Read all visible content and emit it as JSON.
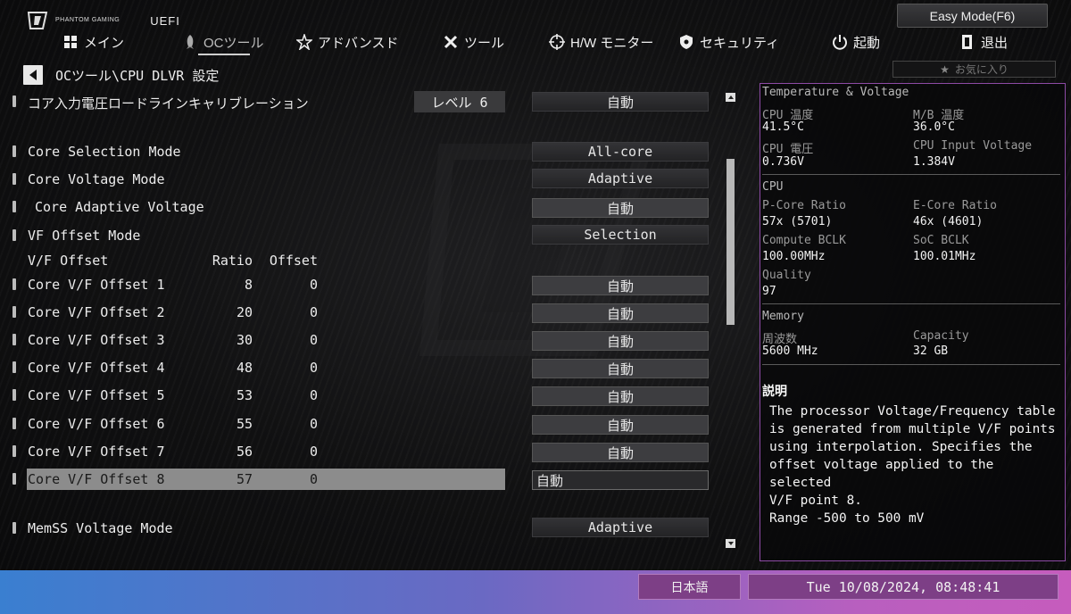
{
  "brand": {
    "logo_text": "PHANTOM GAMING",
    "uefi": "UEFI"
  },
  "easy_mode_label": "Easy Mode(F6)",
  "nav": [
    {
      "id": "main",
      "label": "メイン",
      "icon": "grid-icon"
    },
    {
      "id": "oc",
      "label": "OCツール",
      "icon": "rocket-icon",
      "active": true
    },
    {
      "id": "advanced",
      "label": "アドバンスド",
      "icon": "star-icon"
    },
    {
      "id": "tool",
      "label": "ツール",
      "icon": "tools-icon"
    },
    {
      "id": "hw",
      "label": "H/W モニター",
      "icon": "crosshair-icon"
    },
    {
      "id": "security",
      "label": "セキュリティ",
      "icon": "shield-icon"
    },
    {
      "id": "boot",
      "label": "起動",
      "icon": "power-icon"
    },
    {
      "id": "exit",
      "label": "退出",
      "icon": "exit-icon"
    }
  ],
  "favorites_label": "お気に入り",
  "breadcrumb": "OCツール\\CPU DLVR 設定",
  "settings": {
    "llc": {
      "label": "コア入力電圧ロードラインキャリブレーション",
      "level": "レベル 6",
      "value": "自動"
    },
    "core_selection": {
      "label": "Core Selection Mode",
      "value": "All-core"
    },
    "core_voltage_mode": {
      "label": "Core Voltage Mode",
      "value": "Adaptive"
    },
    "core_adaptive": {
      "label": "Core Adaptive Voltage",
      "value": "自動"
    },
    "vf_offset_mode": {
      "label": "VF Offset Mode",
      "value": "Selection"
    },
    "vf_header": {
      "col1": "V/F Offset",
      "col2": "Ratio",
      "col3": "Offset"
    },
    "vf_rows": [
      {
        "label": "Core V/F Offset 1",
        "ratio": "8",
        "offset": "0",
        "value": "自動"
      },
      {
        "label": "Core V/F Offset 2",
        "ratio": "20",
        "offset": "0",
        "value": "自動"
      },
      {
        "label": "Core V/F Offset 3",
        "ratio": "30",
        "offset": "0",
        "value": "自動"
      },
      {
        "label": "Core V/F Offset 4",
        "ratio": "48",
        "offset": "0",
        "value": "自動"
      },
      {
        "label": "Core V/F Offset 5",
        "ratio": "53",
        "offset": "0",
        "value": "自動"
      },
      {
        "label": "Core V/F Offset 6",
        "ratio": "55",
        "offset": "0",
        "value": "自動"
      },
      {
        "label": "Core V/F Offset 7",
        "ratio": "56",
        "offset": "0",
        "value": "自動"
      },
      {
        "label": "Core V/F Offset 8",
        "ratio": "57",
        "offset": "0",
        "value": "自動"
      }
    ],
    "memss": {
      "label": "MemSS Voltage Mode",
      "value": "Adaptive"
    }
  },
  "monitor": {
    "tv_title": "Temperature & Voltage",
    "cpu_temp_label": "CPU 温度",
    "cpu_temp": "41.5°C",
    "mb_temp_label": "M/B 温度",
    "mb_temp": "36.0°C",
    "cpu_volt_label": "CPU 電圧",
    "cpu_volt": "0.736V",
    "cpu_input_label": "CPU Input Voltage",
    "cpu_input": "1.384V",
    "cpu_title": "CPU",
    "pcore_label": "P-Core Ratio",
    "pcore": "57x (5701)",
    "ecore_label": "E-Core Ratio",
    "ecore": "46x (4601)",
    "bclk_label": "Compute BCLK",
    "bclk": "100.00MHz",
    "soc_label": "SoC BCLK",
    "soc": "100.01MHz",
    "quality_label": "Quality",
    "quality": "97",
    "mem_title": "Memory",
    "freq_label": "周波数",
    "freq": "5600 MHz",
    "cap_label": "Capacity",
    "cap": "32 GB",
    "desc_title": "説明",
    "desc": "The processor Voltage/Frequency table\nis generated from multiple V/F points\nusing interpolation. Specifies the\noffset voltage applied to the selected\nV/F point 8.\nRange -500 to 500 mV"
  },
  "footer": {
    "language": "日本語",
    "datetime": "Tue 10/08/2024, 08:48:41"
  },
  "colors": {
    "accent": "#8d4aa5",
    "highlight": "#8c8c8c",
    "bottom_left": "#3a7fd0",
    "bottom_right": "#c65cbd"
  }
}
